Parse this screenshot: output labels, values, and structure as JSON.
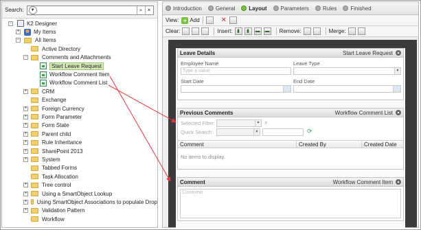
{
  "search": {
    "label": "Search:"
  },
  "tree": {
    "root": "K2 Designer",
    "my_items": "My Items",
    "all_items": "All Items",
    "children": [
      "Active Directory",
      "Comments and Attachments",
      "Start Leave Request",
      "Workflow Comment Item",
      "Workflow Comment List",
      "CRM",
      "Exchange",
      "Foreign Currency",
      "Form Parameter",
      "Form State",
      "Parent child",
      "Rule Inheritance",
      "SharePoint 2013",
      "System",
      "Tabbed Forms",
      "Task Allocation",
      "Tree control",
      "Using a SmartObject Lookup",
      "Using SmartObject Associations to populate Drop",
      "Validation Pattern",
      "Workflow"
    ]
  },
  "tabs": [
    {
      "label": "Introduction",
      "active": false
    },
    {
      "label": "General",
      "active": false
    },
    {
      "label": "Layout",
      "active": true
    },
    {
      "label": "Parameters",
      "active": false
    },
    {
      "label": "Rules",
      "active": false
    },
    {
      "label": "Finished",
      "active": false
    }
  ],
  "toolbar1": {
    "view_label": "View:",
    "add_label": "Add"
  },
  "toolbar2": {
    "clear_label": "Clear:",
    "insert_label": "Insert:",
    "remove_label": "Remove:",
    "merge_label": "Merge:"
  },
  "leave": {
    "title": "Leave Details",
    "right": "Start Leave Request",
    "employee_name": "Employee Name",
    "employee_placeholder": "Type a value",
    "leave_type": "Leave Type",
    "start_date": "Start Date",
    "end_date": "End Date"
  },
  "previous": {
    "title": "Previous Comments",
    "right": "Workflow Comment List",
    "selected_filter": "Selected Filter:",
    "quick_search": "Quick Search:",
    "columns": [
      "Comment",
      "Created By",
      "Created Date"
    ],
    "empty": "No items to display."
  },
  "comment": {
    "title": "Comment",
    "right": "Workflow Comment Item",
    "placeholder": "Comment"
  },
  "colors": {
    "arrow": "#e8323c",
    "canvas": "#3b3b3b",
    "active_tab": "#7cc242",
    "selected_node": "#d5eab8"
  }
}
